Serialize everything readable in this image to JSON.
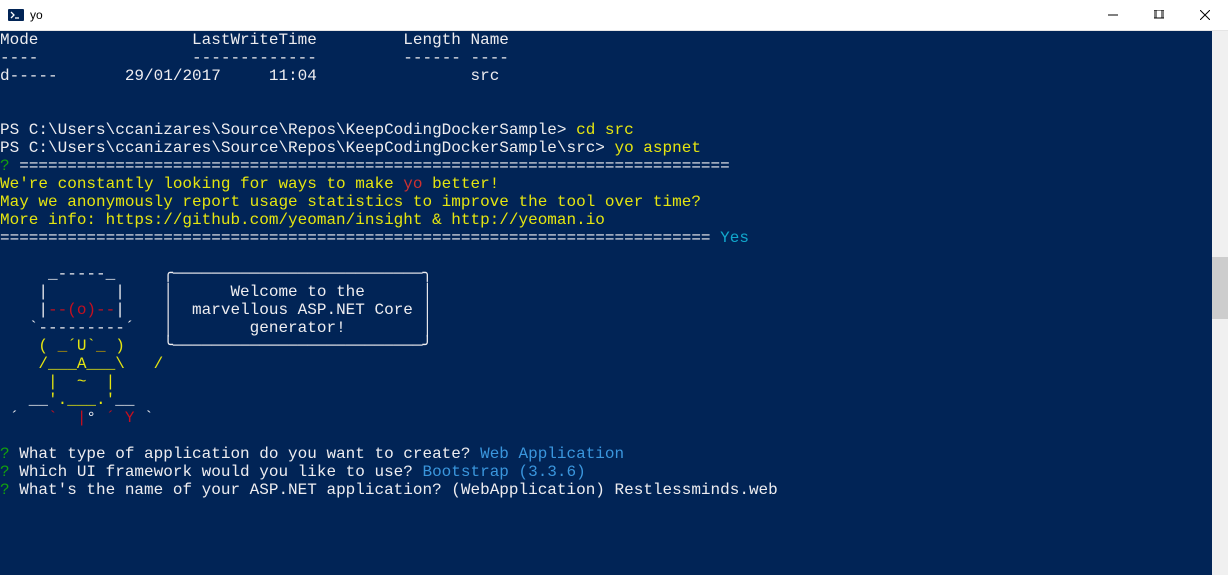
{
  "window": {
    "title": "yo"
  },
  "dir": {
    "header_mode": "Mode",
    "header_lwt": "LastWriteTime",
    "header_len": "Length",
    "header_name": "Name",
    "dash_mode": "----",
    "dash_lwt": "-------------",
    "dash_len": "------",
    "dash_name": "----",
    "row_mode": "d-----",
    "row_date": "29/01/2017",
    "row_time": "11:04",
    "row_name": "src"
  },
  "prompt1": {
    "ps": "PS C:\\Users\\ccanizares\\Source\\Repos\\KeepCodingDockerSample> ",
    "cmd": "cd src"
  },
  "prompt2": {
    "ps": "PS C:\\Users\\ccanizares\\Source\\Repos\\KeepCodingDockerSample\\src> ",
    "cmd": "yo aspnet"
  },
  "notice": {
    "qmark": "?",
    "divider1": " ==========================================================================",
    "line1a": "We're constantly looking for ways to make ",
    "line1b": "yo",
    "line1c": " better!",
    "line2": "May we anonymously report usage statistics to improve the tool over time?",
    "line3": "More info: https://github.com/yeoman/insight & http://yeoman.io",
    "divider2": "========================================================================== ",
    "answer": "Yes"
  },
  "ascii": {
    "l1a": "     _-----_     ",
    "l1b": "╭──────────────────────────╮",
    "l2a": "    |       |    ",
    "l2b": "│      Welcome to the      │",
    "l3a": "    |",
    "l3b": "--(o)--",
    "l3c": "|    ",
    "l3d": "│  marvellous ASP.NET Core │",
    "l4a": "   `---------´   ",
    "l4b": "│        generator!        │",
    "l5a": "    ",
    "l5b": "( ",
    "l5c": "_",
    "l5d": "´U`",
    "l5e": "_",
    "l5f": " )",
    "l5g": "    ",
    "l5h": "╰──────────────────────────╯",
    "l6": "    /___A___\\   /",
    "l7a": "     ",
    "l7b": "|  ~  |",
    "l8": "   __",
    "l8b": "'.___.'",
    "l8c": "__",
    "l9a": " ´   ",
    "l9b": "`  |",
    "l9c": "° ",
    "l9d": "´ Y",
    "l9e": " `"
  },
  "q1": {
    "qmark": "?",
    "text": " What type of application do you want to create?",
    "answer": " Web Application"
  },
  "q2": {
    "qmark": "?",
    "text": " Which UI framework would you like to use?",
    "answer": " Bootstrap (3.3.6)"
  },
  "q3": {
    "qmark": "?",
    "text": " What's the name of your ASP.NET application? ",
    "default": "(WebApplication) ",
    "input": "Restlessminds.web"
  }
}
